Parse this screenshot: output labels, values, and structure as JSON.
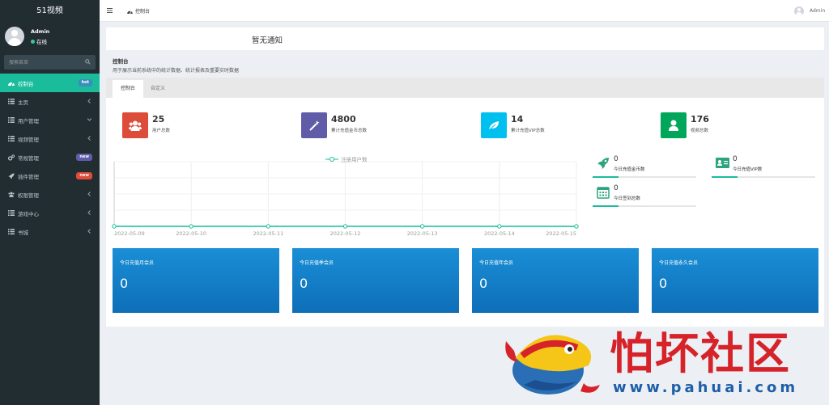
{
  "sidebar": {
    "brand": "51视频",
    "user_name": "Admin",
    "user_status": "在线",
    "search_placeholder": "搜索菜单",
    "menu": [
      {
        "label": "控制台",
        "icon": "dashboard-icon",
        "badge": "hot",
        "badge_color": "#3c8dbc",
        "active": true
      },
      {
        "label": "主页",
        "icon": "list-icon",
        "chevron": "left"
      },
      {
        "label": "用户管理",
        "icon": "list-icon",
        "chevron": "down"
      },
      {
        "label": "视频管理",
        "icon": "list-icon",
        "chevron": "left"
      },
      {
        "label": "常规管理",
        "icon": "cogs-icon",
        "badge": "new",
        "badge_color": "#605ca8"
      },
      {
        "label": "插件管理",
        "icon": "rocket-icon",
        "badge": "new",
        "badge_color": "#dd4b39"
      },
      {
        "label": "权限管理",
        "icon": "group-icon",
        "chevron": "left"
      },
      {
        "label": "游戏中心",
        "icon": "list-icon",
        "chevron": "left"
      },
      {
        "label": "书城",
        "icon": "list-icon",
        "chevron": "left"
      }
    ]
  },
  "topbar": {
    "tab_label": "控制台",
    "user_name": "Admin"
  },
  "notice": "暂无通知",
  "page": {
    "title": "控制台",
    "description": "用于展示当前系统中的统计数据、统计报表及重要实时数据"
  },
  "tabs": [
    "控制台",
    "自定义"
  ],
  "stats": [
    {
      "value": "25",
      "label": "用户总数",
      "color": "#dd4b39",
      "icon": "users-icon"
    },
    {
      "value": "4800",
      "label": "累计充值金币总数",
      "color": "#605ca8",
      "icon": "magic-wand-icon"
    },
    {
      "value": "14",
      "label": "累计充值VIP总数",
      "color": "#00c0ef",
      "icon": "leaf-icon"
    },
    {
      "value": "176",
      "label": "视频总数",
      "color": "#00a65a",
      "icon": "user-icon"
    }
  ],
  "chart_data": {
    "type": "line",
    "series": [
      {
        "name": "注册用户数",
        "values": [
          0,
          0,
          0,
          0,
          0,
          0,
          0
        ],
        "color": "#1abc9c"
      }
    ],
    "categories": [
      "2022-05-09",
      "2022-05-10",
      "2022-05-11",
      "2022-05-12",
      "2022-05-13",
      "2022-05-14",
      "2022-05-15"
    ],
    "xlabel": "",
    "ylabel": "",
    "grid": true,
    "legend": "top-center"
  },
  "mini_stats": [
    {
      "value": "0",
      "label": "今日充值金币数",
      "icon": "rocket-icon"
    },
    {
      "value": "0",
      "label": "今日充值VIP数",
      "icon": "vcard-icon"
    },
    {
      "value": "0",
      "label": "今日签到总数",
      "icon": "calendar-icon"
    }
  ],
  "member_cards": [
    {
      "label": "今日充值月会员",
      "value": "0"
    },
    {
      "label": "今日充值季会员",
      "value": "0"
    },
    {
      "label": "今日充值年会员",
      "value": "0"
    },
    {
      "label": "今日充值永久会员",
      "value": "0"
    }
  ],
  "watermark": {
    "text": "怕坏社区",
    "url": "www.pahuai.com"
  }
}
